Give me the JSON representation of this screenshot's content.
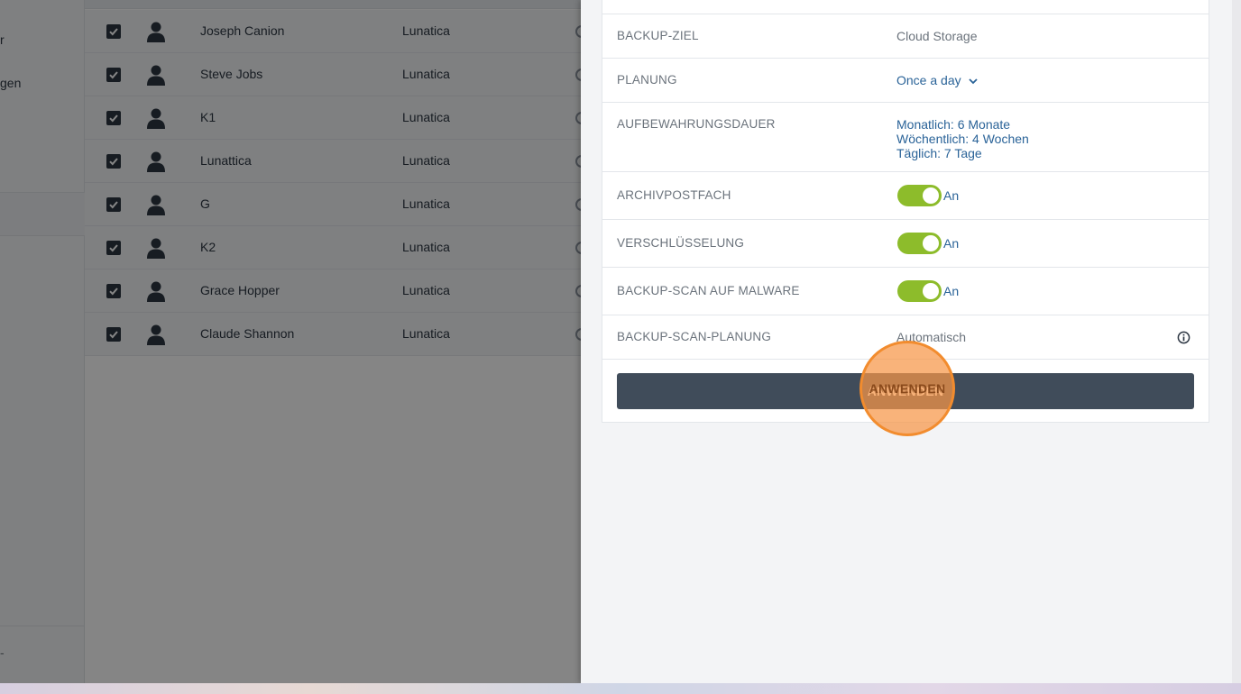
{
  "sidebar": {
    "items": [
      {
        "label": "r"
      },
      {
        "label": "gen"
      },
      {
        "label": ""
      },
      {
        "label": "-"
      }
    ]
  },
  "mailbox_table": {
    "rows": [
      {
        "name": "Joseph Canion",
        "organization": "Lunatica",
        "checked": true
      },
      {
        "name": "Steve Jobs",
        "organization": "Lunatica",
        "checked": true
      },
      {
        "name": "K1",
        "organization": "Lunatica",
        "checked": true
      },
      {
        "name": "Lunattica",
        "organization": "Lunatica",
        "checked": true
      },
      {
        "name": "G",
        "organization": "Lunatica",
        "checked": true
      },
      {
        "name": "K2",
        "organization": "Lunatica",
        "checked": true
      },
      {
        "name": "Grace Hopper",
        "organization": "Lunatica",
        "checked": true
      },
      {
        "name": "Claude Shannon",
        "organization": "Lunatica",
        "checked": true
      }
    ]
  },
  "settings_panel": {
    "backup_target": {
      "label": "BACKUP-ZIEL",
      "value": "Cloud Storage"
    },
    "schedule": {
      "label": "PLANUNG",
      "value": "Once a day"
    },
    "retention": {
      "label": "AUFBEWAHRUNGSDAUER",
      "monthly": "Monatlich: 6 Monate",
      "weekly": "Wöchentlich: 4 Wochen",
      "daily": "Täglich: 7 Tage"
    },
    "archive_mailbox": {
      "label": "ARCHIVPOSTFACH",
      "state": "An"
    },
    "encryption": {
      "label": "VERSCHLÜSSELUNG",
      "state": "An"
    },
    "malware_scan": {
      "label": "BACKUP-SCAN AUF MALWARE",
      "state": "An"
    },
    "scan_schedule": {
      "label": "BACKUP-SCAN-PLANUNG",
      "value": "Automatisch"
    },
    "apply_button": "ANWENDEN"
  },
  "colors": {
    "toggle_on": "#8dbc2b",
    "link": "#2a6398",
    "button": "#404c5a",
    "highlight": "#f28c2e"
  },
  "icons": [
    "checkbox-checked-icon",
    "user-avatar-icon",
    "chevron-down-icon",
    "info-icon"
  ]
}
